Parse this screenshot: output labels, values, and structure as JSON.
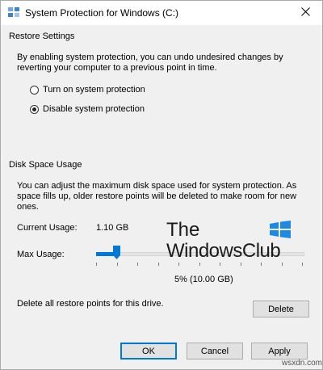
{
  "window": {
    "title": "System Protection for Windows (C:)",
    "close_glyph": "✕"
  },
  "restore_settings": {
    "heading": "Restore Settings",
    "description_line1": "By enabling system protection, you can undo undesired changes by",
    "description_line2": "reverting your computer to a previous point in time.",
    "options": [
      {
        "label": "Turn on system protection",
        "checked": false
      },
      {
        "label": "Disable system protection",
        "checked": true
      }
    ]
  },
  "disk_space": {
    "heading": "Disk Space Usage",
    "description_line1": "You can adjust the maximum disk space used for system protection. As",
    "description_line2": "space fills up, older restore points will be deleted to make room for new",
    "description_line3": "ones.",
    "current_usage_label": "Current Usage:",
    "current_usage_value": "1.10 GB",
    "max_usage_label": "Max Usage:",
    "max_usage_percent": 5,
    "max_usage_text": "5% (10.00 GB)",
    "delete_text": "Delete all restore points for this drive.",
    "delete_label": "Delete"
  },
  "watermark": {
    "line1": "The",
    "line2": "WindowsClub"
  },
  "footer": {
    "ok_label": "OK",
    "cancel_label": "Cancel",
    "apply_label": "Apply"
  },
  "source_mark": "wsxdn.com",
  "colors": {
    "accent": "#0078d7",
    "dialog_bg": "#f0f0f0",
    "button_bg": "#e1e1e1",
    "button_border": "#adadad"
  }
}
